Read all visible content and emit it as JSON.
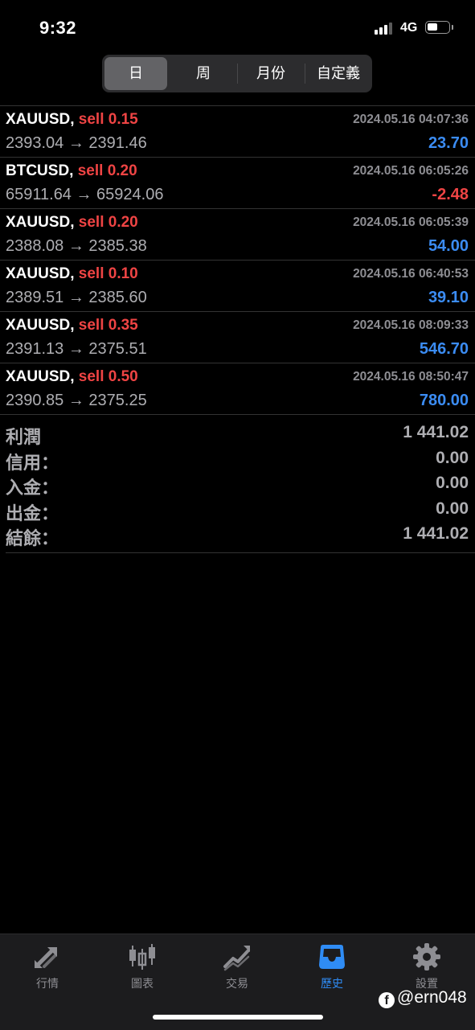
{
  "status": {
    "time": "9:32",
    "network": "4G"
  },
  "period_tabs": [
    {
      "label": "日",
      "active": true
    },
    {
      "label": "周",
      "active": false
    },
    {
      "label": "月份",
      "active": false
    },
    {
      "label": "自定義",
      "active": false
    }
  ],
  "trades": [
    {
      "symbol": "XAUUSD,",
      "side": "sell 0.15",
      "datetime": "2024.05.16 04:07:36",
      "prices": "2393.04 → 2391.46",
      "profit": "23.70",
      "profit_sign": "positive"
    },
    {
      "symbol": "BTCUSD,",
      "side": "sell 0.20",
      "datetime": "2024.05.16 06:05:26",
      "prices": "65911.64 → 65924.06",
      "profit": "-2.48",
      "profit_sign": "negative"
    },
    {
      "symbol": "XAUUSD,",
      "side": "sell 0.20",
      "datetime": "2024.05.16 06:05:39",
      "prices": "2388.08 → 2385.38",
      "profit": "54.00",
      "profit_sign": "positive"
    },
    {
      "symbol": "XAUUSD,",
      "side": "sell 0.10",
      "datetime": "2024.05.16 06:40:53",
      "prices": "2389.51 → 2385.60",
      "profit": "39.10",
      "profit_sign": "positive"
    },
    {
      "symbol": "XAUUSD,",
      "side": "sell 0.35",
      "datetime": "2024.05.16 08:09:33",
      "prices": "2391.13 → 2375.51",
      "profit": "546.70",
      "profit_sign": "positive"
    },
    {
      "symbol": "XAUUSD,",
      "side": "sell 0.50",
      "datetime": "2024.05.16 08:50:47",
      "prices": "2390.85 → 2375.25",
      "profit": "780.00",
      "profit_sign": "positive"
    }
  ],
  "summary": [
    {
      "label": "利潤",
      "value": "1 441.02"
    },
    {
      "label": "信用：",
      "value": "0.00"
    },
    {
      "label": "入金：",
      "value": "0.00"
    },
    {
      "label": "出金：",
      "value": "0.00"
    },
    {
      "label": "結餘：",
      "value": "1 441.02"
    }
  ],
  "tabbar": [
    {
      "label": "行情",
      "icon": "quotes-arrows-icon",
      "active": false
    },
    {
      "label": "圖表",
      "icon": "candlestick-chart-icon",
      "active": false
    },
    {
      "label": "交易",
      "icon": "trade-trend-icon",
      "active": false
    },
    {
      "label": "歷史",
      "icon": "history-inbox-icon",
      "active": true
    },
    {
      "label": "設置",
      "icon": "settings-gear-icon",
      "active": false
    }
  ],
  "watermark": "@ern048",
  "colors": {
    "loss": "#ef4444",
    "profit": "#3b8cf3",
    "active_tab": "#2f8cf5"
  }
}
